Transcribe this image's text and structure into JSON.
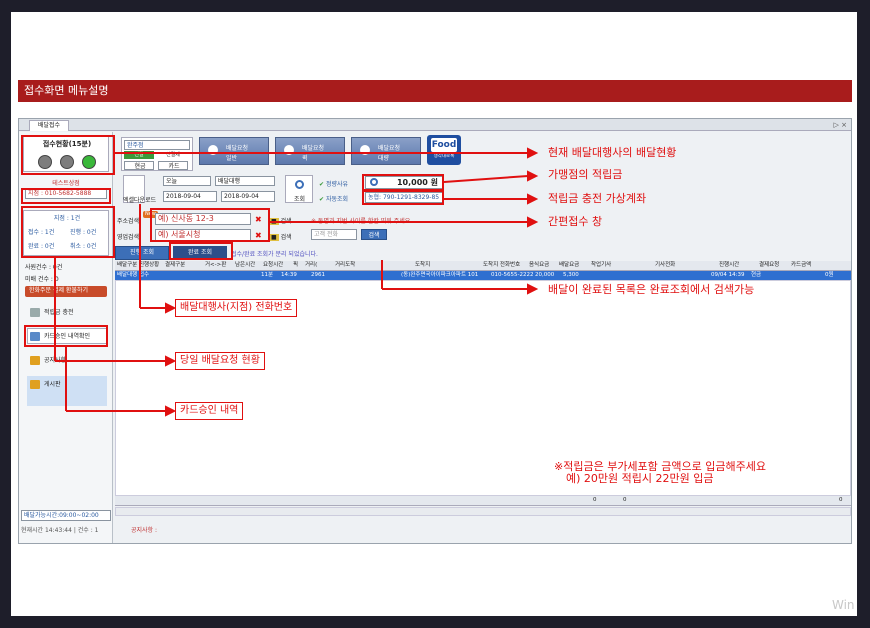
{
  "slide_title": "접수화면 메뉴설명",
  "app": {
    "tab_label": "배달접수",
    "tab_arrows": "▷ ×",
    "status_title": "접수현황(15분)",
    "test_center": "테스트상점",
    "branch_phone": "지점 : 010-5682-5888",
    "branch_counts": {
      "head": "지점 : 1건",
      "r1a": "접수 : 1건",
      "r1b": "진행 : 0건",
      "r2a": "완료 : 0건",
      "r2b": "취소 : 0건"
    },
    "rider_count": "사원건수 : 0건",
    "rider_count2": "미배 건수 : 0",
    "charge_btn": "한화주문 결제 환불하기",
    "menu": [
      {
        "label": "적립금 충전",
        "icon": "wallet-icon",
        "color": "#9aa"
      },
      {
        "label": "카드승인 내역확인",
        "icon": "card-icon",
        "color": "#5a8ac8"
      },
      {
        "label": "공지사항",
        "icon": "notice-icon",
        "color": "#e0a020"
      },
      {
        "label": "게시판",
        "icon": "board-icon",
        "color": "#e0a020"
      }
    ],
    "delivery_time": "배달가능시간:09:00~02:00",
    "bottom_status": "현재시간 14:43:44 | 건수 : 1",
    "bottom_notice": "공지사항 :",
    "store_name": "완주점",
    "store_tags": [
      "선결",
      "신결제",
      "현금",
      "카드"
    ],
    "buttons_top": [
      {
        "label": "배달요청",
        "sub": "일반"
      },
      {
        "label": "배달요청",
        "sub": "퀵"
      },
      {
        "label": "배달요청",
        "sub": "대량"
      }
    ],
    "food_logo": "Food",
    "food_sub": "생각대로록",
    "date_from": "2018-09-04",
    "date_to": "2018-09-04",
    "period": "오늘",
    "status_select": "배달대행",
    "search_label": "조회",
    "excel_label": "엑셀다운로드",
    "check_label1": "정량사유",
    "check_label2": "자동조회",
    "points_value": "10,000 원",
    "account": "농협: 790-1291-8329-85",
    "addr_label": "주소검색",
    "new_badge": "New",
    "addr_value": "예) 신사동 12-3",
    "search_btn": "검색",
    "addr_hint": "※ 동명과 지번 사이를 한칸 띄워 주세요.",
    "shop_label": "영업검색",
    "shop_value": "예) 서울시청",
    "customer_label": "고객 전화",
    "search_btn2": "검색",
    "tab_progress": "진행 조회",
    "tab_done": "완료 조회",
    "tab_hint": "접수/완료 조회가 분리 되었습니다.",
    "grid_headers": [
      "배달구분",
      "진행상황",
      "결제구분",
      "거<->판",
      "남은시간",
      "요청시간",
      "픽",
      "거리(",
      "거리도착",
      "도착지",
      "도착지 전화번호",
      "음식요금",
      "배달요금",
      "착업기사",
      "기사전화",
      "진행시간",
      "결제요청",
      "카드금액"
    ],
    "grid_row": [
      "배달대행",
      "접수",
      "",
      "",
      "11분",
      "14:39",
      "",
      "2961",
      "",
      "(동)완주면국아이파크아파트 101",
      "010-5655-2222",
      "20,000",
      "5,300",
      "",
      "",
      "09/04 14:39",
      "현금",
      "0원"
    ],
    "footer_vals": [
      "0",
      "0",
      "0"
    ]
  },
  "callouts": {
    "c1": "현재 배달대행사의 배달현황",
    "c2": "가맹점의 적립금",
    "c3": "적립금 충전 가상계좌",
    "c4": "간편접수 창",
    "c5": "배달이 완료된 목록은 완료조회에서 검색가능",
    "c6": "배달대행사(지점) 전화번호",
    "c7": "당일 배달요청 현황",
    "c8": "카드승인 내역",
    "note1": "※적립금은 부가세포함 금액으로 입금해주세요",
    "note2": "예) 20만원 적립시 22만원 입금"
  },
  "watermark": "Win",
  "colors": {
    "title_bar": "#a81c1c",
    "callout": "#e01010",
    "grid_row": "#2f6fd0",
    "lamp_gray": "#7d7d7d",
    "lamp_green": "#3ab83a"
  }
}
